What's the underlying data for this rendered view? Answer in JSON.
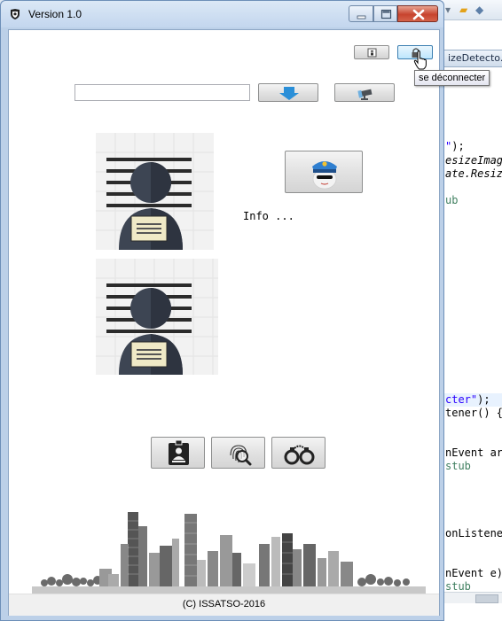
{
  "window": {
    "title": "Version 1.0"
  },
  "toolbar": {
    "info_button_icon": "info-icon",
    "logout_button_icon": "lock-icon",
    "logout_tooltip": "se déconnecter"
  },
  "search": {
    "value": "",
    "placeholder": ""
  },
  "actions": {
    "download_icon": "arrow-down-icon",
    "camera_icon": "camera-icon",
    "police_icon": "police-officer-icon"
  },
  "info": {
    "label": "Info ..."
  },
  "bottom_buttons": [
    {
      "icon": "id-badge-icon"
    },
    {
      "icon": "fingerprint-search-icon"
    },
    {
      "icon": "handcuffs-icon"
    }
  ],
  "footer": {
    "text": "(C) ISSATSO-2016"
  },
  "ide": {
    "tab_label": "izeDetecto...",
    "lines": [
      {
        "str": "\"",
        "rest": ");"
      },
      {
        "text": "esizeImage("
      },
      {
        "text": "ate.Resize"
      },
      {
        "cmt": "ub"
      },
      {
        "str": "cter\"",
        "rest": ");"
      },
      {
        "text": "tener() {"
      },
      {
        "text": "nEvent arg"
      },
      {
        "cmt": "stub"
      },
      {
        "text": "onListener"
      },
      {
        "text": "nEvent e)"
      },
      {
        "cmt": "stub"
      }
    ]
  },
  "colors": {
    "title_bar": "#c3d6ee",
    "close_button": "#c7432e",
    "accent_blue": "#2a8fd8"
  }
}
